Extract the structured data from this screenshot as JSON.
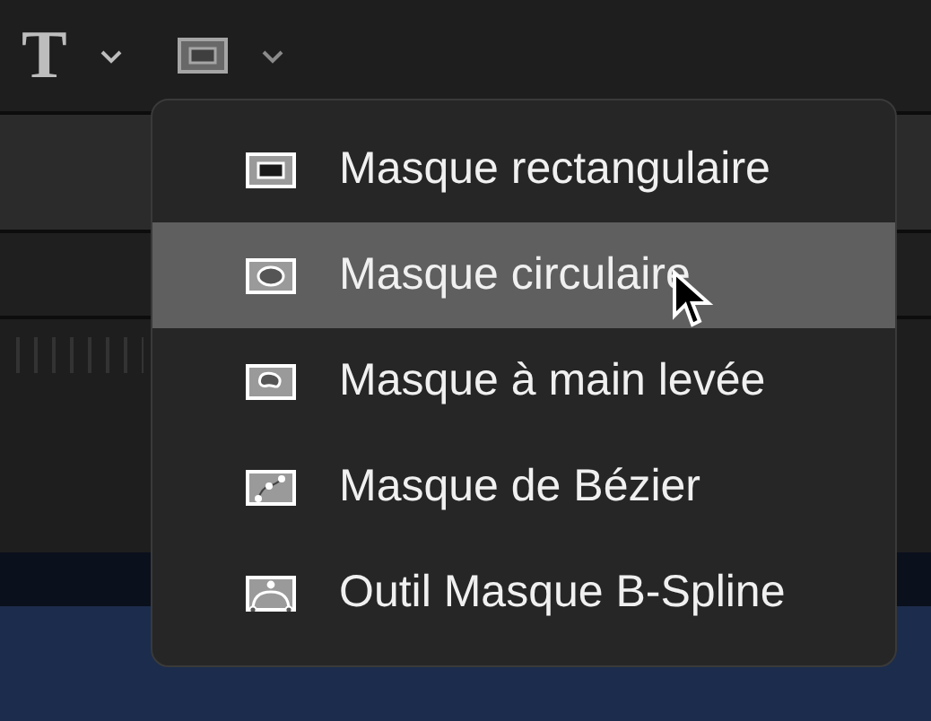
{
  "toolbar": {
    "text_tool": "T",
    "shape_tool": {
      "kind": "rect"
    }
  },
  "menu": {
    "items": [
      {
        "label": "Masque rectangulaire",
        "kind": "rect",
        "selected": false
      },
      {
        "label": "Masque circulaire",
        "kind": "circle",
        "selected": true
      },
      {
        "label": "Masque à main levée",
        "kind": "freehand",
        "selected": false
      },
      {
        "label": "Masque de Bézier",
        "kind": "bezier",
        "selected": false
      },
      {
        "label": "Outil Masque B-Spline",
        "kind": "bspline",
        "selected": false
      }
    ]
  }
}
